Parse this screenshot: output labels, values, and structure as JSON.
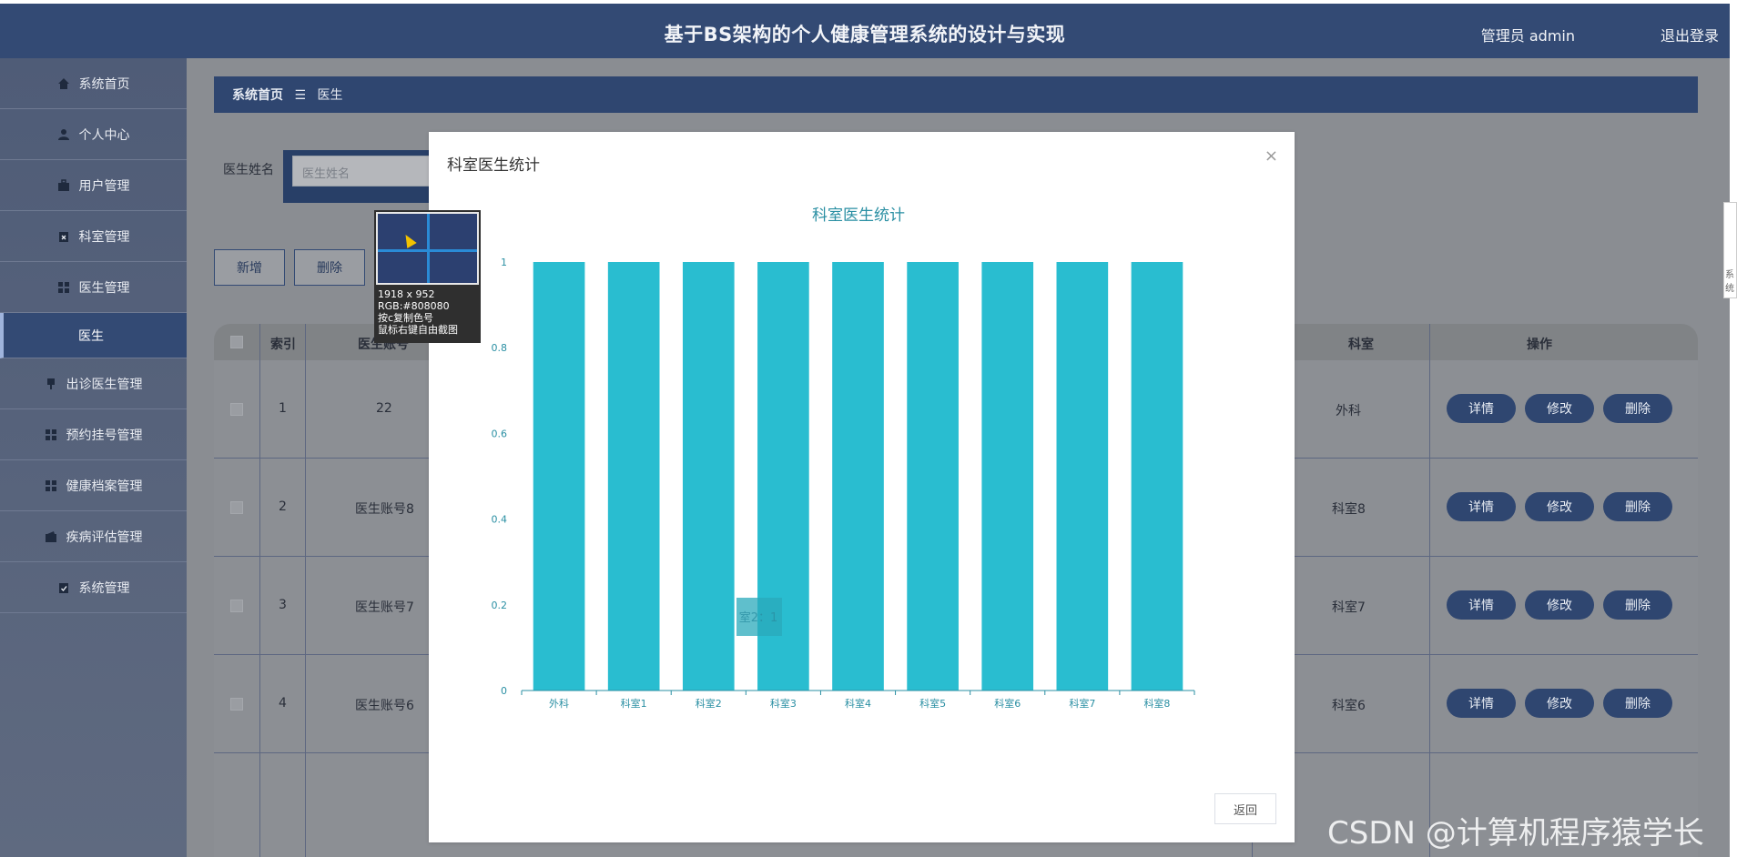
{
  "header": {
    "title": "基于BS架构的个人健康管理系统的设计与实现",
    "user_label": "管理员 admin",
    "logout_label": "退出登录"
  },
  "sidebar": {
    "items": [
      {
        "label": "系统首页",
        "icon": "home-icon"
      },
      {
        "label": "个人中心",
        "icon": "person-icon"
      },
      {
        "label": "用户管理",
        "icon": "briefcase-icon"
      },
      {
        "label": "科室管理",
        "icon": "clipboard-x-icon"
      },
      {
        "label": "医生管理",
        "icon": "grid-icon"
      },
      {
        "label": "医生",
        "icon": ""
      },
      {
        "label": "出诊医生管理",
        "icon": "stamp-icon"
      },
      {
        "label": "预约挂号管理",
        "icon": "grid-icon"
      },
      {
        "label": "健康档案管理",
        "icon": "grid-icon"
      },
      {
        "label": "疾病评估管理",
        "icon": "wallet-icon"
      },
      {
        "label": "系统管理",
        "icon": "clipboard-check-icon"
      }
    ]
  },
  "breadcrumb": {
    "home": "系统首页",
    "separator": "☰",
    "current": "医生"
  },
  "search": {
    "label": "医生姓名",
    "placeholder": "医生姓名"
  },
  "toolbar": {
    "add_label": "新增",
    "delete_label": "删除"
  },
  "table": {
    "headers": {
      "index": "索引",
      "account": "医生账号",
      "department": "科室",
      "actions": "操作"
    },
    "rows": [
      {
        "index": "1",
        "account": "22",
        "department": "外科"
      },
      {
        "index": "2",
        "account": "医生账号8",
        "department": "科室8"
      },
      {
        "index": "3",
        "account": "医生账号7",
        "department": "科室7"
      },
      {
        "index": "4",
        "account": "医生账号6",
        "department": "科室6"
      }
    ],
    "action_labels": {
      "detail": "详情",
      "edit": "修改",
      "delete": "删除"
    }
  },
  "modal": {
    "title": "科室医生统计",
    "close_glyph": "×",
    "return_label": "返回",
    "tooltip_text": "室2：1"
  },
  "picker": {
    "size": "1918 x 952",
    "rgb": "RGB:#808080",
    "hint1": "按c复制色号",
    "hint2": "鼠标右键自由截图"
  },
  "edge_panel_text": "系统",
  "watermark": "CSDN @计算机程序猿学长",
  "colors": {
    "header_bg": "#334a74",
    "bar_color": "#29bdd0",
    "chart_text": "#2a8fa3",
    "pill_bg": "#2f4670"
  },
  "chart_data": {
    "type": "bar",
    "title": "科室医生统计",
    "categories": [
      "外科",
      "科室1",
      "科室2",
      "科室3",
      "科室4",
      "科室5",
      "科室6",
      "科室7",
      "科室8"
    ],
    "values": [
      1,
      1,
      1,
      1,
      1,
      1,
      1,
      1,
      1
    ],
    "yticks": [
      "0",
      "0.2",
      "0.4",
      "0.6",
      "0.8",
      "1"
    ],
    "ylim": [
      0,
      1
    ],
    "xlabel": "",
    "ylabel": "",
    "grid": false
  }
}
